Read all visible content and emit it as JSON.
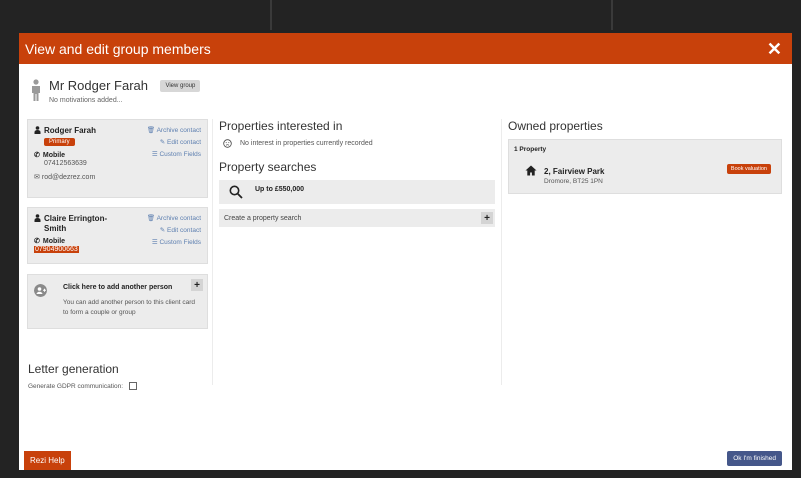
{
  "modal": {
    "title": "View and edit group members",
    "close_label": "✕"
  },
  "group": {
    "person_name": "Mr Rodger Farah",
    "view_group_label": "View group",
    "motivations": "No motivations added..."
  },
  "contacts": [
    {
      "name": "Rodger Farah",
      "badge": "Primary",
      "phone_type": "Mobile",
      "phone": "07412563639",
      "email": "rod@dezrez.com",
      "archive_label": "Archive contact",
      "edit_label": "Edit contact",
      "custom_label": "Custom Fields"
    },
    {
      "name": "Claire Errington-Smith",
      "phone_type": "Mobile",
      "phone": "07904900663",
      "archive_label": "Archive contact",
      "edit_label": "Edit contact",
      "custom_label": "Custom Fields"
    }
  ],
  "add_person": {
    "title": "Click here to add another person",
    "description": "You can add another person to this client card to form a couple or group",
    "plus": "+"
  },
  "properties_interested": {
    "title": "Properties interested in",
    "empty": "No interest in properties currently recorded"
  },
  "property_searches": {
    "title": "Property searches",
    "search_item": "Up to £550,000",
    "create_label": "Create a property search",
    "plus": "+"
  },
  "owned_properties": {
    "title": "Owned properties",
    "count": "1 Property",
    "address_line1": "2, Fairview Park",
    "address_line2": "Dromore, BT25 1PN",
    "book_label": "Book valuation"
  },
  "letters": {
    "title": "Letter generation",
    "gdpr_label": "Generate GDPR communication:"
  },
  "footer": {
    "help_label": "Rezi Help",
    "ok_label": "Ok I'm finished"
  },
  "colors": {
    "accent": "#c8410b",
    "primary_button": "#45578a",
    "link": "#5d7fb0"
  }
}
